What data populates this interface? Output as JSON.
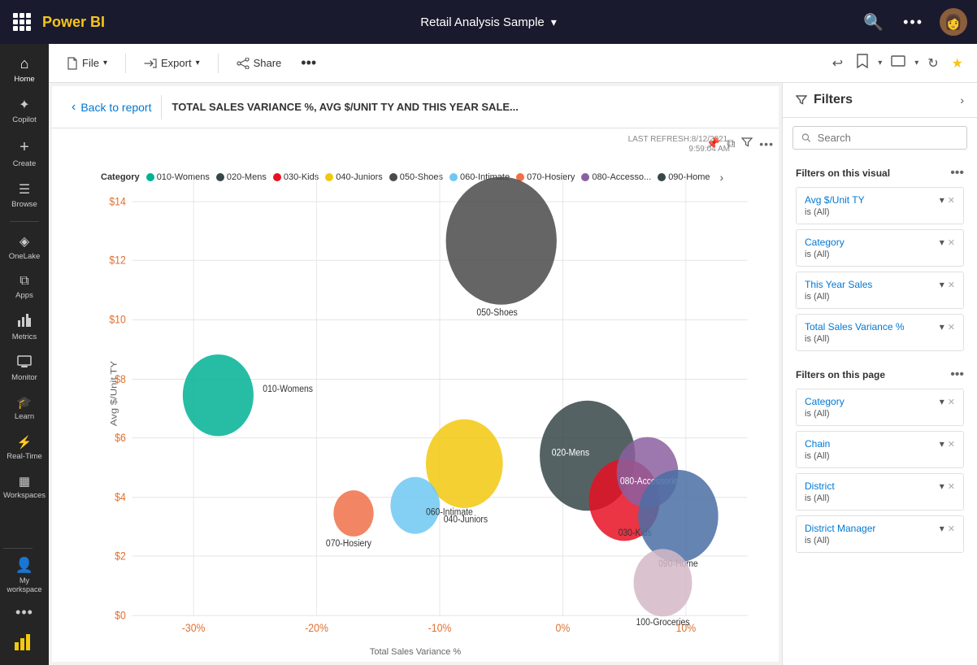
{
  "app": {
    "name": "Power BI",
    "report_title": "Retail Analysis Sample",
    "report_title_chevron": "▾"
  },
  "toolbar": {
    "file_label": "File",
    "export_label": "Export",
    "share_label": "Share"
  },
  "breadcrumb": {
    "back_label": "Back to report",
    "chart_title": "TOTAL SALES VARIANCE %, AVG $/UNIT TY AND THIS YEAR SALE..."
  },
  "refresh": {
    "last_refresh_label": "LAST REFRESH:8/12/2021,",
    "time_label": "9:59:04 AM"
  },
  "filters": {
    "title": "Filters",
    "search_placeholder": "Search",
    "on_visual_label": "Filters on this visual",
    "on_page_label": "Filters on this page",
    "visual_filters": [
      {
        "name": "Avg $/Unit TY",
        "value": "is (All)"
      },
      {
        "name": "Category",
        "value": "is (All)"
      },
      {
        "name": "This Year Sales",
        "value": "is (All)"
      },
      {
        "name": "Total Sales Variance %",
        "value": "is (All)"
      }
    ],
    "page_filters": [
      {
        "name": "Category",
        "value": "is (All)"
      },
      {
        "name": "Chain",
        "value": "is (All)"
      },
      {
        "name": "District",
        "value": "is (All)"
      },
      {
        "name": "District Manager",
        "value": "is (All)"
      }
    ]
  },
  "legend": {
    "category_label": "Category",
    "items": [
      {
        "label": "010-Womens",
        "color": "#00b294"
      },
      {
        "label": "020-Mens",
        "color": "#374649"
      },
      {
        "label": "030-Kids",
        "color": "#e81123"
      },
      {
        "label": "040-Juniors",
        "color": "#f2c80f"
      },
      {
        "label": "050-Shoes",
        "color": "#4a4a4a"
      },
      {
        "label": "060-Intimate",
        "color": "#6dc8f2"
      },
      {
        "label": "070-Hosiery",
        "color": "#f07048"
      },
      {
        "label": "080-Accesso...",
        "color": "#8b60a0"
      },
      {
        "label": "090-Home",
        "color": "#374649"
      }
    ]
  },
  "chart": {
    "y_axis_label": "Avg $/Unit TY",
    "x_axis_label": "Total Sales Variance %",
    "y_ticks": [
      "$0",
      "$2",
      "$4",
      "$6",
      "$8",
      "$10",
      "$12",
      "$14"
    ],
    "x_ticks": [
      "-30%",
      "-20%",
      "-10%",
      "0%",
      "10%"
    ],
    "bubbles": [
      {
        "label": "010-Womens",
        "x": -28,
        "y": 8,
        "r": 38,
        "color": "#00b294"
      },
      {
        "label": "020-Mens",
        "x": 2,
        "y": 5.8,
        "r": 55,
        "color": "#374649"
      },
      {
        "label": "030-Kids",
        "x": 5,
        "y": 4.2,
        "r": 40,
        "color": "#e81123"
      },
      {
        "label": "040-Juniors",
        "x": -8,
        "y": 5.5,
        "r": 44,
        "color": "#f2c80f"
      },
      {
        "label": "050-Shoes",
        "x": -6,
        "y": 13.5,
        "r": 60,
        "color": "#4a4a4a"
      },
      {
        "label": "060-Intimate",
        "x": -12,
        "y": 4.0,
        "r": 28,
        "color": "#6dc8f2"
      },
      {
        "label": "070-Hosiery",
        "x": -17,
        "y": 3.7,
        "r": 22,
        "color": "#f07048"
      },
      {
        "label": "080-Accessories",
        "x": 4,
        "y": 5.2,
        "r": 35,
        "color": "#8b60a0"
      },
      {
        "label": "090-Home",
        "x": 8,
        "y": 3.6,
        "r": 45,
        "color": "#4a6fa5"
      },
      {
        "label": "100-Groceries",
        "x": 5,
        "y": 1.2,
        "r": 32,
        "color": "#d4b8c7"
      }
    ]
  },
  "sidebar": {
    "items": [
      {
        "label": "Home",
        "icon": "⌂"
      },
      {
        "label": "Copilot",
        "icon": "✦"
      },
      {
        "label": "Create",
        "icon": "+"
      },
      {
        "label": "Browse",
        "icon": "☰"
      },
      {
        "label": "OneLake",
        "icon": "◈"
      },
      {
        "label": "Apps",
        "icon": "⧉"
      },
      {
        "label": "Metrics",
        "icon": "📊"
      },
      {
        "label": "Monitor",
        "icon": "👁"
      },
      {
        "label": "Learn",
        "icon": "🎓"
      },
      {
        "label": "Real-Time",
        "icon": "⚡"
      },
      {
        "label": "Workspaces",
        "icon": "▦"
      }
    ],
    "bottom_items": [
      {
        "label": "My workspace",
        "icon": "👤"
      },
      {
        "label": "More",
        "icon": "..."
      }
    ]
  }
}
